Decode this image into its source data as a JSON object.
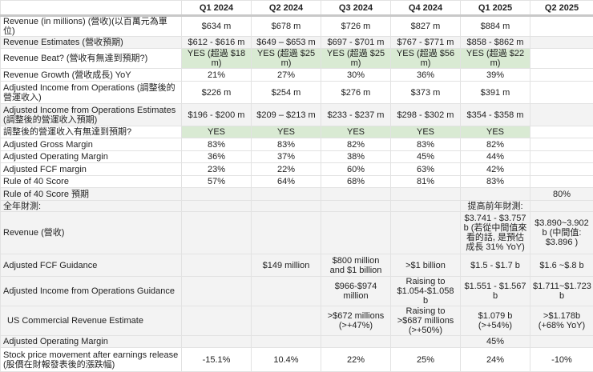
{
  "columns": [
    "",
    "Q1 2024",
    "Q2 2024",
    "Q3 2024",
    "Q4 2024",
    "Q1 2025",
    "Q2 2025"
  ],
  "rows": [
    {
      "label": "Revenue (in millions) (營收)(以百萬元為單位)",
      "values": [
        "$634 m",
        "$678 m",
        "$726 m",
        "$827 m",
        "$884 m",
        ""
      ]
    },
    {
      "label": "Revenue Estimates (營收預期)",
      "values": [
        "$612 - $616 m",
        "$649 – $653 m",
        "$697 - $701 m",
        "$767 - $771 m",
        "$858 - $862 m",
        ""
      ],
      "shade": "gray"
    },
    {
      "label": "Revenue Beat? (營收有無達到預期?)",
      "values": [
        "YES (超過 $18 m)",
        "YES (超過 $25 m)",
        "YES (超過 $25 m)",
        "YES (超過 $56 m)",
        "YES (超過 $22 m)",
        ""
      ],
      "highlight": true
    },
    {
      "label": "Revenue Growth (營收成長) YoY",
      "values": [
        "21%",
        "27%",
        "30%",
        "36%",
        "39%",
        ""
      ]
    },
    {
      "label": "Adjusted Income from Operations (調整後的營運收入)",
      "values": [
        "$226 m",
        "$254 m",
        "$276 m",
        "$373 m",
        "$391 m",
        ""
      ]
    },
    {
      "label": "Adjusted Income from Operations Estimates (調整後的營運收入預期)",
      "values": [
        "$196 - $200 m",
        "$209 – $213 m",
        "$233 - $237 m",
        "$298 - $302 m",
        "$354 - $358 m",
        ""
      ],
      "shade": "gray"
    },
    {
      "label": "調整後的營運收入有無達到預期?",
      "values": [
        "YES",
        "YES",
        "YES",
        "YES",
        "YES",
        ""
      ],
      "highlight": true
    },
    {
      "label": "Adjusted Gross Margin",
      "values": [
        "83%",
        "83%",
        "82%",
        "83%",
        "82%",
        ""
      ]
    },
    {
      "label": "Adjusted Operating Margin",
      "values": [
        "36%",
        "37%",
        "38%",
        "45%",
        "44%",
        ""
      ]
    },
    {
      "label": "Adjusted FCF margin",
      "values": [
        "23%",
        "22%",
        "60%",
        "63%",
        "42%",
        ""
      ]
    },
    {
      "label": "Rule of 40 Score",
      "values": [
        "57%",
        "64%",
        "68%",
        "81%",
        "83%",
        ""
      ]
    },
    {
      "label": "Rule of 40 Score 預期",
      "values": [
        "",
        "",
        "",
        "",
        "",
        "80%"
      ],
      "shade": "gray"
    },
    {
      "label": "全年財測:",
      "values": [
        "",
        "",
        "",
        "",
        "提高前年財測:",
        ""
      ],
      "shade": "gray"
    },
    {
      "label": "Revenue (營收)",
      "values": [
        "",
        "",
        "",
        "",
        "$3.741 - $3.757 b (若從中間值來看的話, 是預估成長 31% YoY)",
        "$3.890~3.902 b (中間值: $3.896 )"
      ],
      "shade": "gray"
    },
    {
      "label": "Adjusted FCF Guidance",
      "values": [
        "",
        "$149 million",
        "$800 million and $1 billion",
        ">$1 billion",
        "$1.5 - $1.7 b",
        "$1.6 ~$.8 b"
      ],
      "shade": "gray"
    },
    {
      "label": "Adjusted Income from Operations Guidance",
      "values": [
        "",
        "",
        "$966-$974 million",
        "Raising to $1.054-$1.058 b",
        "$1.551 - $1.567 b",
        "$1.711~$1.723 b"
      ],
      "shade": "gray"
    },
    {
      "label": "US Commercial Revenue Estimate",
      "values": [
        "",
        "",
        ">$672 millions (>+47%)",
        "Raising to >$687 millions (>+50%)",
        "$1.079 b (>+54%)",
        ">$1.178b (+68% YoY)"
      ],
      "shade": "gray",
      "indent": true
    },
    {
      "label": "Adjusted Operating Margin",
      "values": [
        "",
        "",
        "",
        "",
        "45%",
        ""
      ],
      "shade": "gray"
    },
    {
      "label": "Stock price movement after earnings release (股價在財報發表後的漲跌幅)",
      "values": [
        "-15.1%",
        "10.4%",
        "22%",
        "25%",
        "24%",
        "-10%"
      ]
    }
  ]
}
